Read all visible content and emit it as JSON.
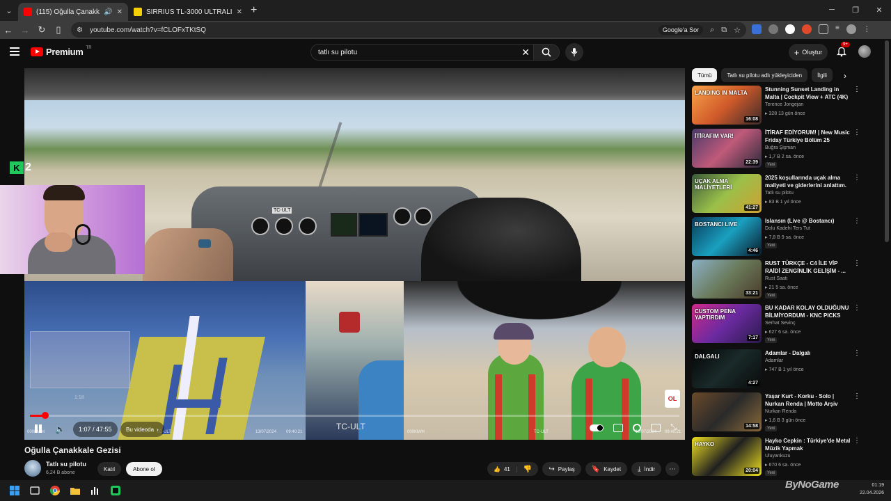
{
  "browser": {
    "tabs": [
      {
        "title": "(115) Oğulla Çanakkale Gezi",
        "active": true
      },
      {
        "title": "SIRRIUS TL-3000 ULTRALIGHT U",
        "active": false
      }
    ],
    "url": "youtube.com/watch?v=fCLOFxTKtSQ",
    "google_sor": "Google'a Sor"
  },
  "youtube": {
    "logo_text": "Premium",
    "logo_region": "TR",
    "search_value": "tatlı su pilotu",
    "create_label": "Oluştur",
    "notif_count": "9+"
  },
  "player": {
    "time": "1:07 / 47:55",
    "chapter": "Bu videoda",
    "cam_label": "TC-ULT",
    "hover_time": "1:18",
    "hud_speed_left": "000KM/H",
    "hud_speed_right": "000KM/H",
    "hud_date_left": "13/07/2024",
    "hud_time_left": "09:40:21",
    "hud_date_right": "13/07/2024",
    "hud_time_right": "09:40:21",
    "hud_reg_left": "TC-ULT",
    "hud_reg_right": "TC-ULT",
    "progress_fraction": 0.023,
    "stream_badge": "2",
    "ol_badge": "OL"
  },
  "video": {
    "title": "Oğulla Çanakkale Gezisi",
    "channel": "Tatlı su pilotu",
    "subscribers": "6,24 B abone",
    "join_label": "Katıl",
    "subscribe_label": "Abone ol",
    "likes": "41",
    "share_label": "Paylaş",
    "save_label": "Kaydet",
    "download_label": "İndir"
  },
  "chips": [
    "Tümü",
    "Tatlı su pilotu adlı yükleyiciden",
    "İlgili"
  ],
  "recommendations": [
    {
      "title": "Stunning Sunset Landing in Malta | Cockpit View + ATC (4K)",
      "channel": "Terence Jongejan",
      "meta": "328  13 gün önce",
      "duration": "16:08",
      "new": ""
    },
    {
      "title": "İTİRAF EDİYORUM! | New Music Friday Türkiye Bölüm 25",
      "channel": "Buğra Şişman",
      "meta": "1,7 B  2 sa. önce",
      "duration": "22:39",
      "new": "Yeni"
    },
    {
      "title": "2025 koşullarında uçak alma maliyeti ve giderlerini anlattım.",
      "channel": "Tatlı su pilotu",
      "meta": "83 B  1 yıl önce",
      "duration": "41:27",
      "new": ""
    },
    {
      "title": "Islansın (Live @ Bostancı)",
      "channel": "Dolu Kadehi Ters Tut",
      "meta": "7,8 B  9 sa. önce",
      "duration": "4:46",
      "new": "Yeni"
    },
    {
      "title": "RUST TÜRKÇE - C4 İLE VİP RAİDİ ZENGİNLİK GELİŞİM - ...",
      "channel": "Rust Saati",
      "meta": "21  5 sa. önce",
      "duration": "33:21",
      "new": "Yeni"
    },
    {
      "title": "BU KADAR KOLAY OLDUĞUNU BİLMİYORDUM - KNC PICKS",
      "channel": "Serhat Sevinç",
      "meta": "627  6 sa. önce",
      "duration": "7:17",
      "new": "Yeni"
    },
    {
      "title": "Adamlar - Dalgalı",
      "channel": "Adamlar",
      "meta": "747 B  1 yıl önce",
      "duration": "4:27",
      "new": ""
    },
    {
      "title": "Yaşar Kurt - Korku - Solo | Nurkan Renda | Motto Arşiv",
      "channel": "Nurkan Renda",
      "meta": "1,6 B  3 gün önce",
      "duration": "14:58",
      "new": "Yeni"
    },
    {
      "title": "Hayko Cepkin : Türkiye'de Metal Müzik Yapmak",
      "channel": "Uluyankuzu",
      "meta": "670  6 sa. önce",
      "duration": "20:04",
      "new": "Yeni"
    }
  ],
  "thumb_texts": [
    "LANDING IN MALTA",
    "İTİRAFIM VAR!",
    "UÇAK ALMA MALİYETLERİ",
    "BOSTANCI LIVE",
    "",
    "CUSTOM PENA YAPTIRDIM",
    "DALGALI",
    "",
    "HAYKO"
  ],
  "taskbar": {
    "time": "01:19",
    "date": "22.04.2026"
  },
  "watermark": "ByNoGame",
  "colors": {
    "accent": "#ff0000",
    "bg": "#0f0f0f",
    "chip": "#272727"
  }
}
